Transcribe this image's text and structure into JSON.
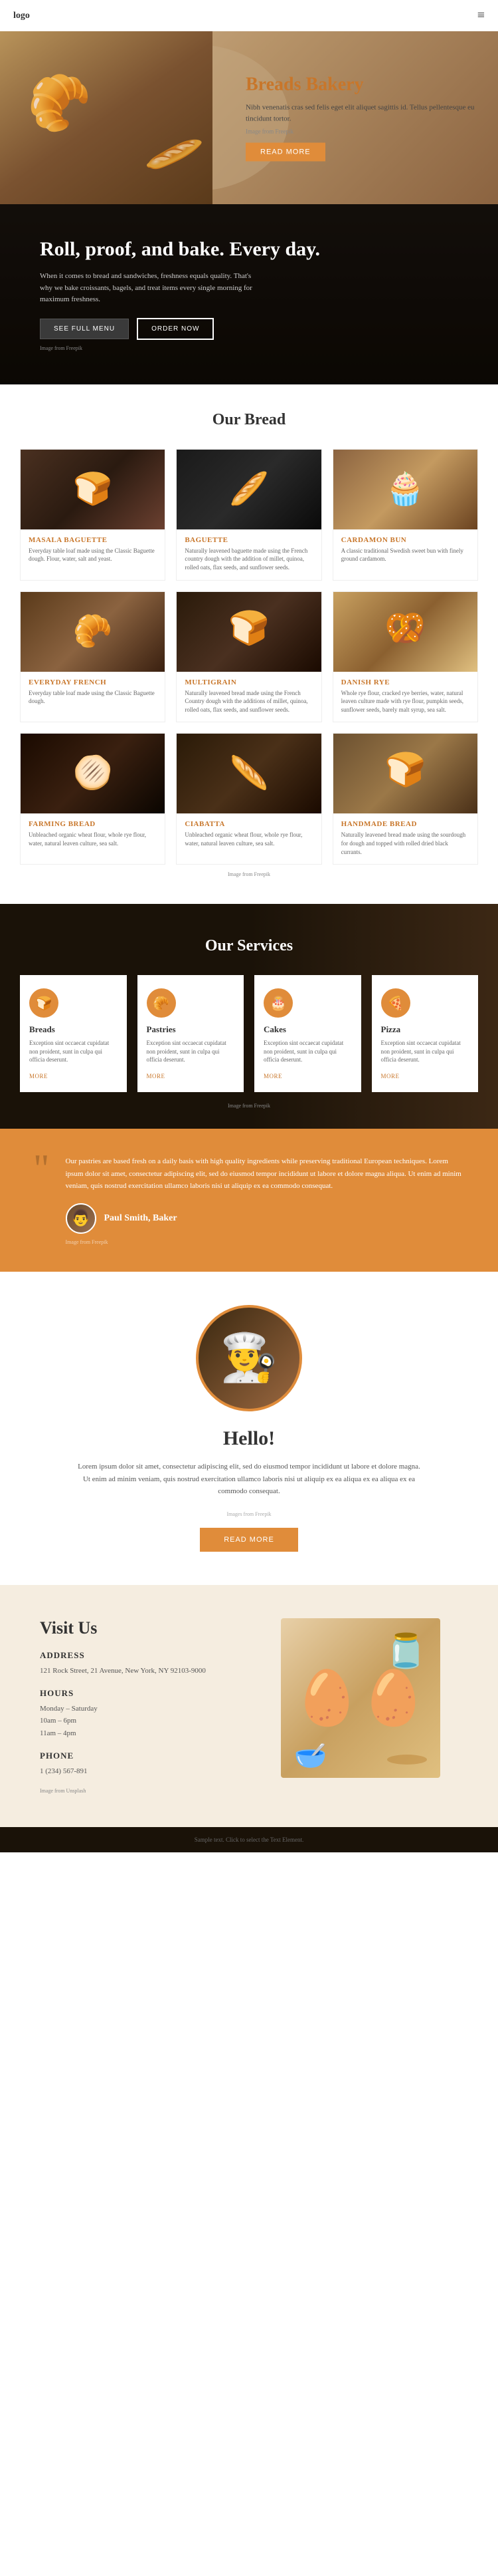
{
  "nav": {
    "logo": "logo",
    "menu_icon": "≡"
  },
  "hero": {
    "title": "Breads Bakery",
    "description": "Nibh venenatis cras sed felis eget elit aliquet sagittis id. Tellus pellentesque eu tincidunt tortor.",
    "image_credit": "Image from Freepik",
    "image_credit_link": "Freepik",
    "cta_label": "READ MORE"
  },
  "fullwidth": {
    "tagline": "Roll, proof, and bake. Every day.",
    "description": "When it comes to bread and sandwiches, freshness equals quality. That's why we bake croissants, bagels, and treat items every single morning for maximum freshness.",
    "btn_menu": "SEE FULL MENU",
    "btn_order": "ORDER NOW",
    "image_credit": "Image from Freepik",
    "image_credit_link": "Freepik"
  },
  "our_bread": {
    "section_title": "Our Bread",
    "items": [
      {
        "name": "Masala Baguette",
        "description": "Everyday table loaf made using the Classic Baguette dough. Flour, water, salt and yeast.",
        "img_type": "masala"
      },
      {
        "name": "Baguette",
        "description": "Naturally leavened baguette made using the French country dough with the addition of millet, quinoa, rolled oats, flax seeds, and sunflower seeds.",
        "img_type": "baguette"
      },
      {
        "name": "Cardamon Bun",
        "description": "A classic traditional Swedish sweet bun with finely ground cardamom.",
        "img_type": "cardamon"
      },
      {
        "name": "Everyday French",
        "description": "Everyday table loaf made using the Classic Baguette dough.",
        "img_type": "french"
      },
      {
        "name": "Multigrain",
        "description": "Naturally leavened bread made using the French Country dough with the additions of millet, quinoa, rolled oats, flax seeds, and sunflower seeds.",
        "img_type": "multigrain"
      },
      {
        "name": "Danish Rye",
        "description": "Whole rye flour, cracked rye berries, water, natural leaven culture made with rye flour, pumpkin seeds, sunflower seeds, barely malt syrup, sea salt.",
        "img_type": "danish"
      },
      {
        "name": "Farming Bread",
        "description": "Unbleached organic wheat flour, whole rye flour, water, natural leaven culture, sea salt.",
        "img_type": "farming"
      },
      {
        "name": "Ciabatta",
        "description": "Unbleached organic wheat flour, whole rye flour, water, natural leaven culture, sea salt.",
        "img_type": "ciabatta"
      },
      {
        "name": "Handmade Bread",
        "description": "Naturally leavened bread made using the sourdough for dough and topped with rolled dried black currants.",
        "img_type": "handmade"
      }
    ],
    "image_credit": "Image from Freepik",
    "image_credit_link": "Freepik"
  },
  "services": {
    "section_title": "Our Services",
    "items": [
      {
        "name": "Breads",
        "description": "Exception sint occaecat cupidatat non proident, sunt in culpa qui officia deserunt.",
        "more_label": "MORE",
        "icon": "🍞"
      },
      {
        "name": "Pastries",
        "description": "Exception sint occaecat cupidatat non proident, sunt in culpa qui officia deserunt.",
        "more_label": "MORE",
        "icon": "🥐"
      },
      {
        "name": "Cakes",
        "description": "Exception sint occaecat cupidatat non proident, sunt in culpa qui officia deserunt.",
        "more_label": "MORE",
        "icon": "🎂"
      },
      {
        "name": "Pizza",
        "description": "Exception sint occaecat cupidatat non proident, sunt in culpa qui officia deserunt.",
        "more_label": "MORE",
        "icon": "🍕"
      }
    ],
    "image_credit": "Image from Freepik",
    "image_credit_link": "Freepik"
  },
  "testimonial": {
    "quote": "Our pastries are based fresh on a daily basis with high quality ingredients while preserving traditional European techniques. Lorem ipsum dolor sit amet, consectetur adipiscing elit, sed do eiusmod tempor incididunt ut labore et dolore magna aliqua. Ut enim ad minim veniam, quis nostrud exercitation ullamco laboris nisi ut aliquip ex ea commodo consequat.",
    "author_name": "Paul Smith, Baker",
    "author_title": "Baker",
    "image_credit": "Image from Freepik",
    "image_credit_link": "Freepik"
  },
  "hello": {
    "section_title": "Hello!",
    "text": "Lorem ipsum dolor sit amet, consectetur adipiscing elit, sed do eiusmod tempor incididunt ut labore et dolore magna. Ut enim ad minim veniam, quis nostrud exercitation ullamco laboris nisi ut aliquip ex ea aliqua ex ea aliqua ex ea commodo consequat.",
    "cta_label": "READ MORE",
    "image_credit": "Images from Freepik",
    "image_credit_link": "Freepik"
  },
  "visit": {
    "section_title": "Visit Us",
    "address_title": "ADDRESS",
    "address": "121 Rock Street, 21 Avenue,\nNew York, NY 92103-9000",
    "hours_title": "HOURS",
    "hours_days": "Monday – Saturday",
    "hours_time": "10am – 6pm",
    "hours_time2": "11am – 4pm",
    "phone_title": "PHONE",
    "phone": "1 (234) 567-891",
    "image_credit": "Image from Unsplash",
    "image_credit_link": "Unsplash"
  },
  "footer": {
    "text": "Sample text. Click to select the Text Element."
  }
}
